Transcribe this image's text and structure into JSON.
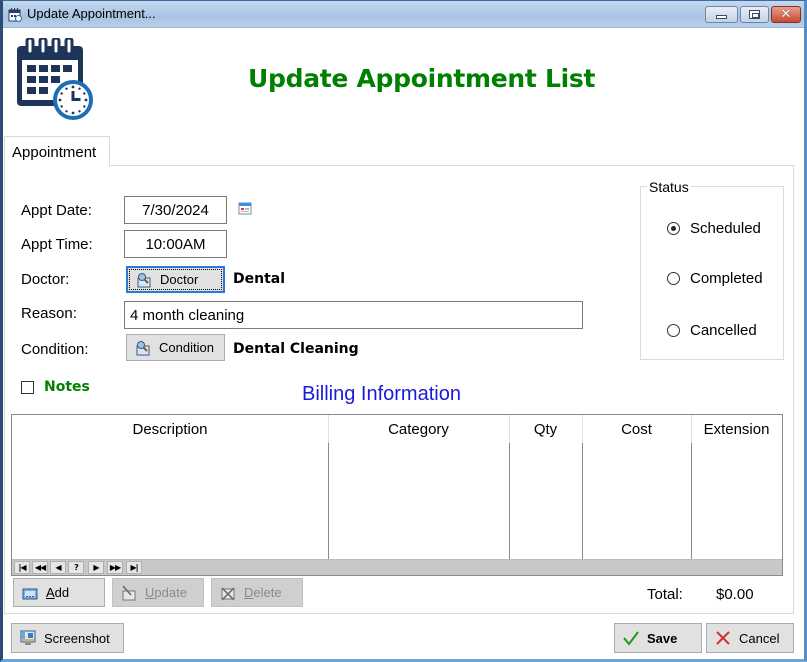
{
  "window": {
    "title": "Update Appointment...",
    "controls": {
      "minimize": "minimize",
      "maximize": "maximize",
      "close": "✕"
    }
  },
  "header": {
    "title": "Update Appointment List",
    "icon": "calendar-clock-icon"
  },
  "tabs": [
    {
      "label": "Appointment",
      "active": true
    }
  ],
  "form": {
    "appt_date": {
      "label": "Appt Date:",
      "value": "7/30/2024"
    },
    "appt_time": {
      "label": "Appt Time:",
      "value": "10:00AM"
    },
    "doctor": {
      "label": "Doctor:",
      "button": "Doctor",
      "value": "Dental"
    },
    "reason": {
      "label": "Reason:",
      "value": "4 month cleaning"
    },
    "condition": {
      "label": "Condition:",
      "button": "Condition",
      "value": "Dental Cleaning"
    }
  },
  "status": {
    "title": "Status",
    "options": [
      {
        "label": "Scheduled",
        "selected": true
      },
      {
        "label": "Completed",
        "selected": false
      },
      {
        "label": "Cancelled",
        "selected": false
      }
    ]
  },
  "notes": {
    "label": "Notes",
    "checked": false
  },
  "billing": {
    "title": "Billing Information",
    "columns": [
      "Description",
      "Category",
      "Qty",
      "Cost",
      "Extension"
    ],
    "rows": [],
    "navigator": [
      "first",
      "prev-page",
      "prev",
      "?",
      "next",
      "next-page",
      "last"
    ],
    "buttons": {
      "add": {
        "accel": "A",
        "rest": "dd",
        "enabled": true
      },
      "update": {
        "accel": "U",
        "rest": "pdate",
        "enabled": false
      },
      "delete": {
        "accel": "D",
        "rest": "elete",
        "enabled": false
      }
    },
    "total_label": "Total:",
    "total_value": "$0.00"
  },
  "footer": {
    "screenshot": "Screenshot",
    "save": "Save",
    "cancel": "Cancel"
  },
  "colors": {
    "title_green": "#008000",
    "billing_blue": "#1a1adc",
    "focus_blue": "#2a7ad4"
  }
}
